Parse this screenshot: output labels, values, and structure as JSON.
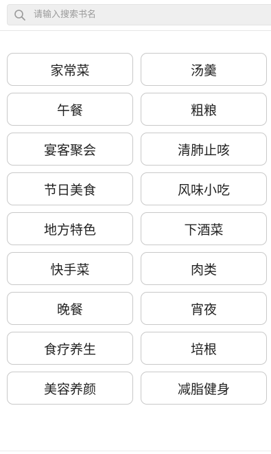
{
  "search": {
    "placeholder": "请输入搜索书名",
    "icon": "search-icon"
  },
  "categories": [
    "家常菜",
    "汤羹",
    "午餐",
    "粗粮",
    "宴客聚会",
    "清肺止咳",
    "节日美食",
    "风味小吃",
    "地方特色",
    "下酒菜",
    "快手菜",
    "肉类",
    "晚餐",
    "宵夜",
    "食疗养生",
    "培根",
    "美容养颜",
    "减脂健身"
  ]
}
